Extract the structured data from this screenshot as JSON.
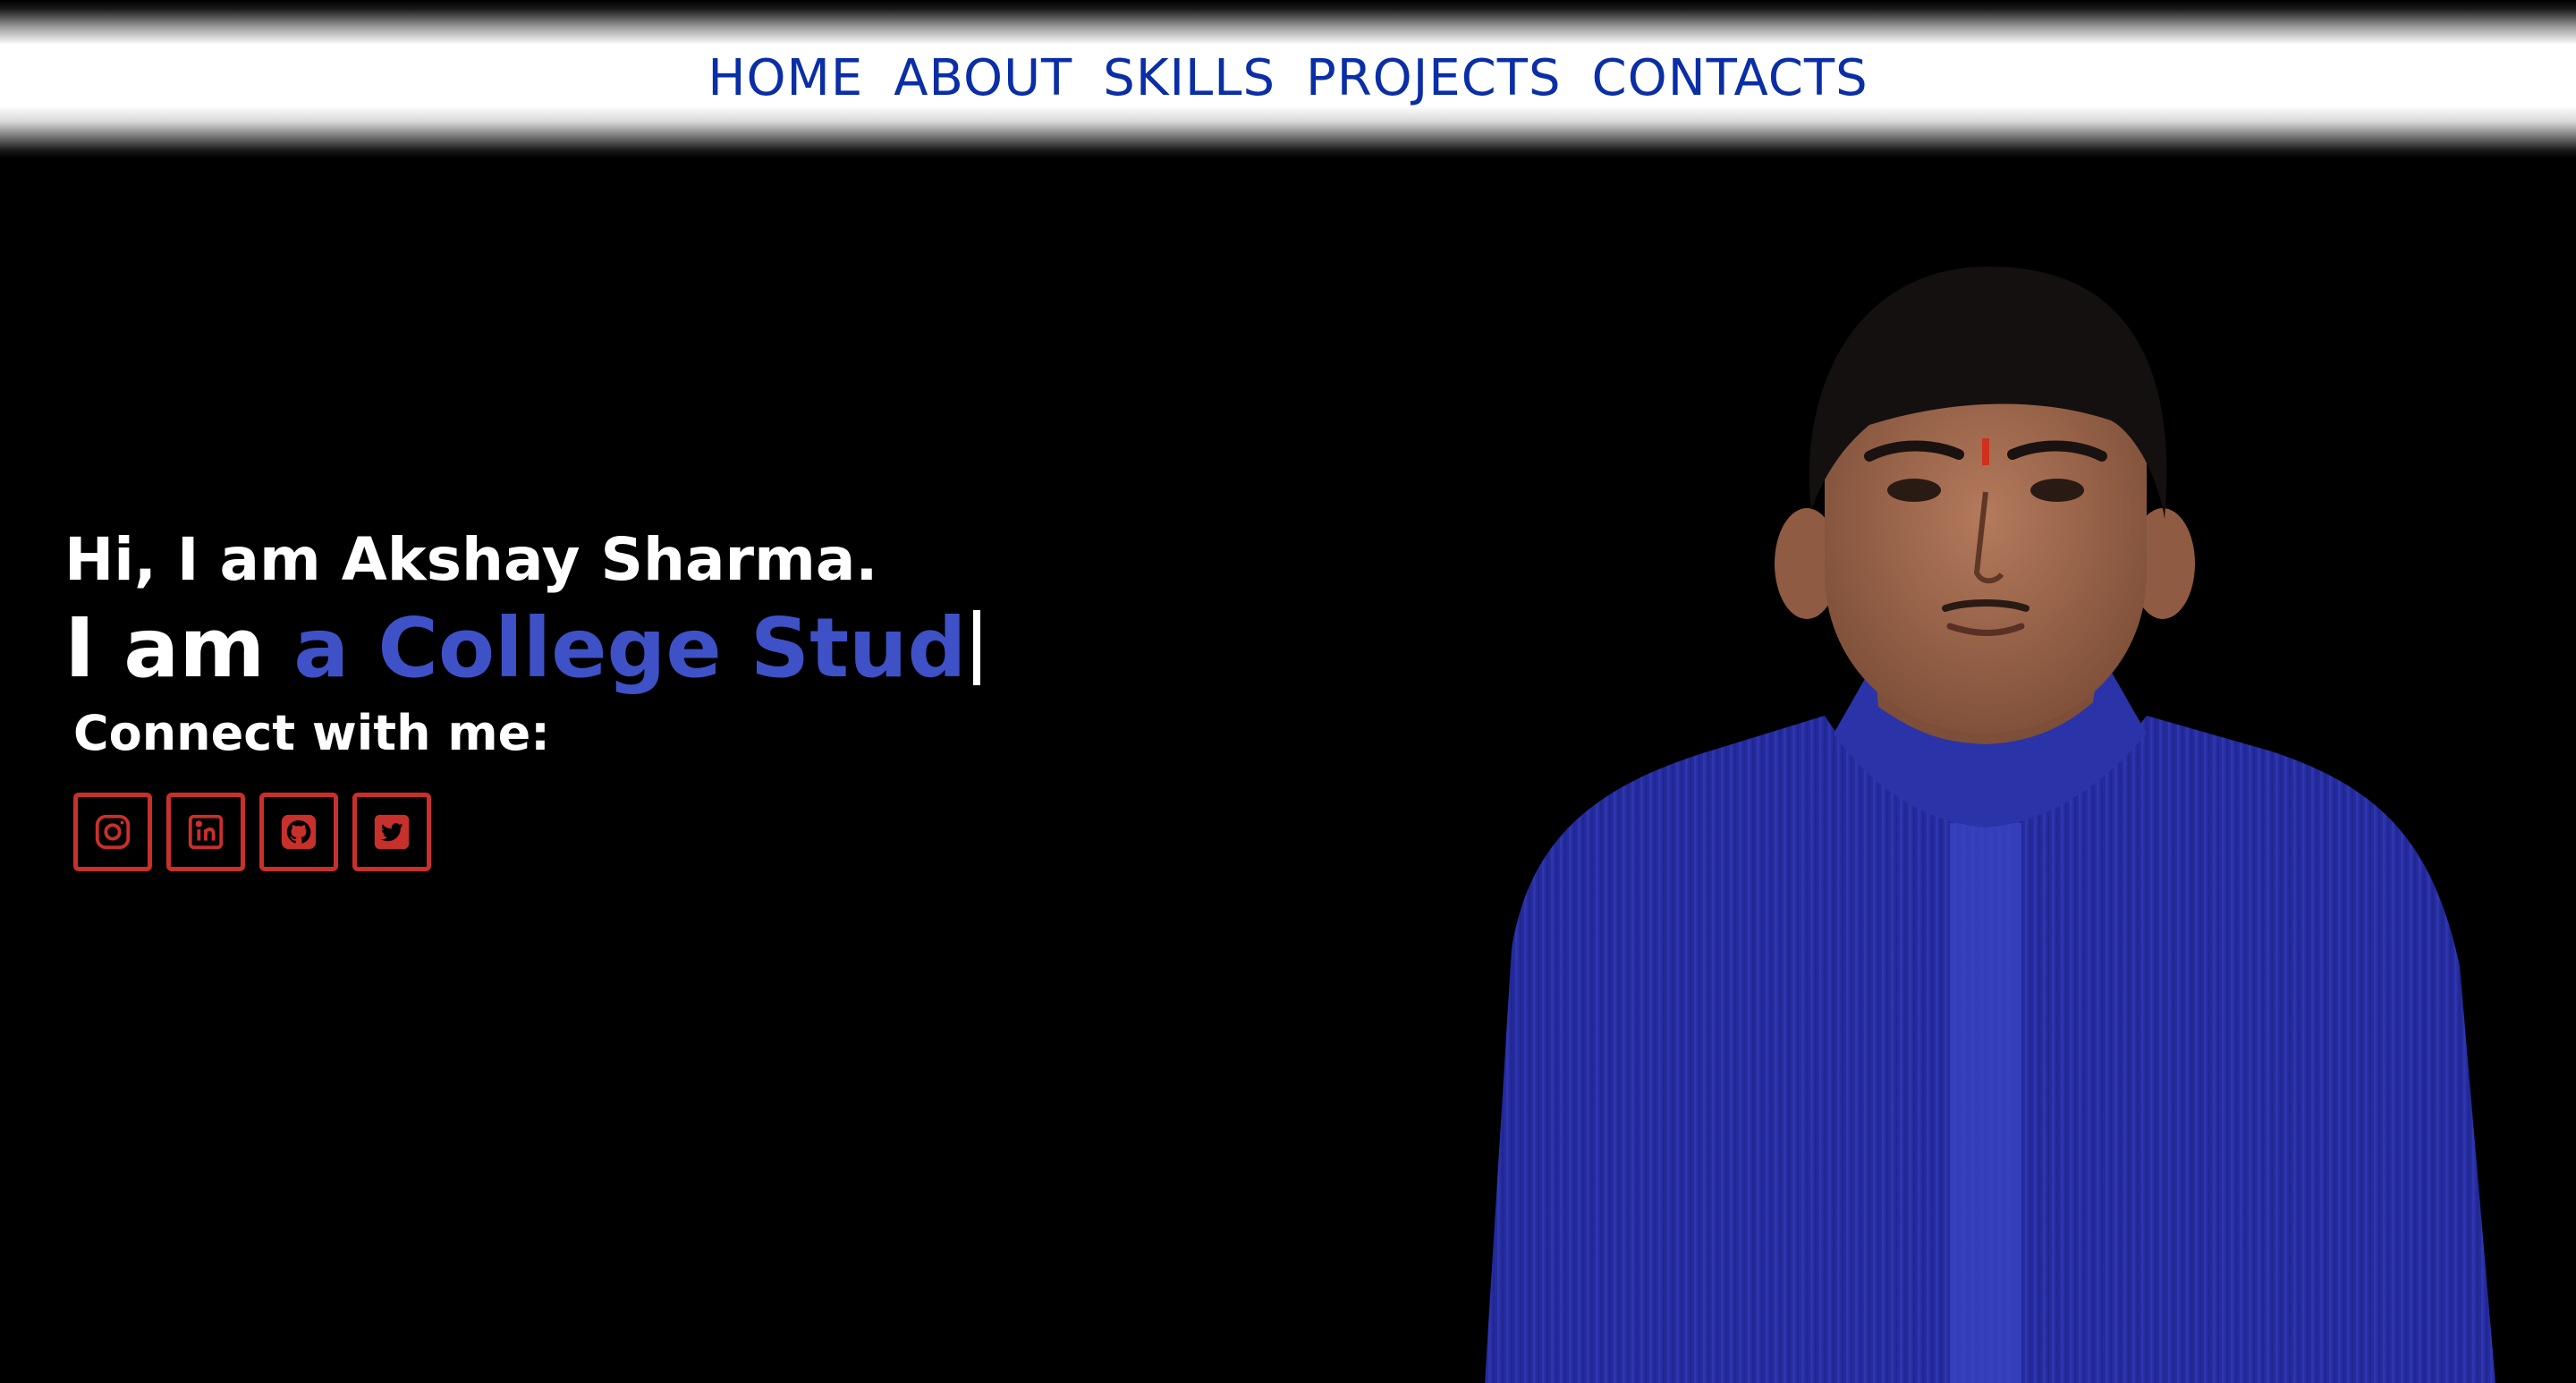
{
  "nav": {
    "items": [
      {
        "label": "HOME"
      },
      {
        "label": "ABOUT"
      },
      {
        "label": "SKILLS"
      },
      {
        "label": "PROJECTS"
      },
      {
        "label": "CONTACTS"
      }
    ]
  },
  "hero": {
    "greeting": "Hi, I am Akshay Sharma.",
    "role_prefix": "I am ",
    "role_typed": "a College Stud",
    "connect_label": "Connect with me:"
  },
  "socials": [
    {
      "icon": "instagram-icon"
    },
    {
      "icon": "linkedin-icon"
    },
    {
      "icon": "github-icon"
    },
    {
      "icon": "twitter-icon"
    }
  ],
  "colors": {
    "nav_text": "#0a2ea6",
    "accent": "#3f51c7",
    "social_border": "#c8302b",
    "background": "#000000",
    "shirt": "#2d35a8"
  }
}
